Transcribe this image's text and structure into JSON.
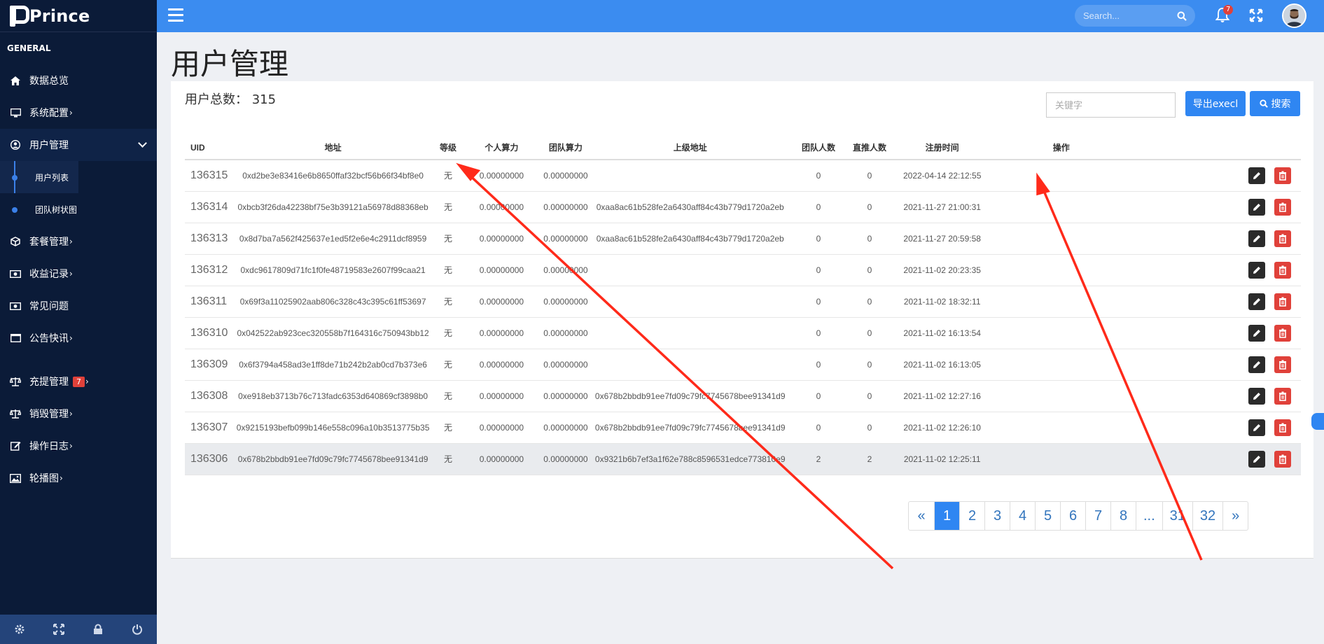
{
  "brand": {
    "name": "Prince"
  },
  "sidebar": {
    "section": "GENERAL",
    "items": [
      {
        "label": "数据总览",
        "icon": "home-icon",
        "arrow": ""
      },
      {
        "label": "系统配置",
        "icon": "monitor-icon",
        "arrow": "›"
      },
      {
        "label": "用户管理",
        "icon": "user-icon",
        "arrow": ""
      },
      {
        "label": "套餐管理",
        "icon": "cube-icon",
        "arrow": "›"
      },
      {
        "label": "收益记录",
        "icon": "money-icon",
        "arrow": "›"
      },
      {
        "label": "常见问题",
        "icon": "money-icon",
        "arrow": ""
      },
      {
        "label": "公告快讯",
        "icon": "window-icon",
        "arrow": "›"
      },
      {
        "label": "充提管理",
        "icon": "scale-icon",
        "arrow": "›",
        "badge": "7"
      },
      {
        "label": "销毁管理",
        "icon": "scale-icon",
        "arrow": "›"
      },
      {
        "label": "操作日志",
        "icon": "edit-icon",
        "arrow": "›"
      },
      {
        "label": "轮播图",
        "icon": "image-icon",
        "arrow": "›"
      }
    ],
    "subitems": [
      {
        "label": "用户列表"
      },
      {
        "label": "团队树状图"
      }
    ]
  },
  "header": {
    "search_placeholder": "Search...",
    "notification_count": "7"
  },
  "page": {
    "title": "用户管理",
    "total_label": "用户总数：",
    "total_value": "315",
    "keyword_placeholder": "关键字",
    "export_label": "导出execl",
    "search_label": "搜索"
  },
  "table": {
    "headers": [
      "UID",
      "地址",
      "等级",
      "个人算力",
      "团队算力",
      "上级地址",
      "团队人数",
      "直推人数",
      "注册时间",
      "操作"
    ],
    "rows": [
      [
        "136315",
        "0xd2be3e83416e6b8650ffaf32bcf56b66f34bf8e0",
        "无",
        "0.00000000",
        "0.00000000",
        "",
        "0",
        "0",
        "2022-04-14 22:12:55"
      ],
      [
        "136314",
        "0xbcb3f26da42238bf75e3b39121a56978d88368eb",
        "无",
        "0.00000000",
        "0.00000000",
        "0xaa8ac61b528fe2a6430aff84c43b779d1720a2eb",
        "0",
        "0",
        "2021-11-27 21:00:31"
      ],
      [
        "136313",
        "0x8d7ba7a562f425637e1ed5f2e6e4c2911dcf8959",
        "无",
        "0.00000000",
        "0.00000000",
        "0xaa8ac61b528fe2a6430aff84c43b779d1720a2eb",
        "0",
        "0",
        "2021-11-27 20:59:58"
      ],
      [
        "136312",
        "0xdc9617809d71fc1f0fe48719583e2607f99caa21",
        "无",
        "0.00000000",
        "0.00000000",
        "",
        "0",
        "0",
        "2021-11-02 20:23:35"
      ],
      [
        "136311",
        "0x69f3a11025902aab806c328c43c395c61ff53697",
        "无",
        "0.00000000",
        "0.00000000",
        "",
        "0",
        "0",
        "2021-11-02 18:32:11"
      ],
      [
        "136310",
        "0x042522ab923cec320558b7f164316c750943bb12",
        "无",
        "0.00000000",
        "0.00000000",
        "",
        "0",
        "0",
        "2021-11-02 16:13:54"
      ],
      [
        "136309",
        "0x6f3794a458ad3e1ff8de71b242b2ab0cd7b373e6",
        "无",
        "0.00000000",
        "0.00000000",
        "",
        "0",
        "0",
        "2021-11-02 16:13:05"
      ],
      [
        "136308",
        "0xe918eb3713b76c713fadc6353d640869cf3898b0",
        "无",
        "0.00000000",
        "0.00000000",
        "0x678b2bbdb91ee7fd09c79fc7745678bee91341d9",
        "0",
        "0",
        "2021-11-02 12:27:16"
      ],
      [
        "136307",
        "0x9215193befb099b146e558c096a10b3513775b35",
        "无",
        "0.00000000",
        "0.00000000",
        "0x678b2bbdb91ee7fd09c79fc7745678bee91341d9",
        "0",
        "0",
        "2021-11-02 12:26:10"
      ],
      [
        "136306",
        "0x678b2bbdb91ee7fd09c79fc7745678bee91341d9",
        "无",
        "0.00000000",
        "0.00000000",
        "0x9321b6b7ef3a1f62e788c8596531edce773810e9",
        "2",
        "2",
        "2021-11-02 12:25:11"
      ]
    ]
  },
  "pagination": [
    "«",
    "1",
    "2",
    "3",
    "4",
    "5",
    "6",
    "7",
    "8",
    "...",
    "31",
    "32",
    "»"
  ],
  "pagination_active": "1",
  "colors": {
    "sidebar": "#0b1b38",
    "topbar": "#3b8cf0",
    "accent": "#2f86f2",
    "danger": "#e0413a",
    "annotation": "#ff2a1a"
  }
}
